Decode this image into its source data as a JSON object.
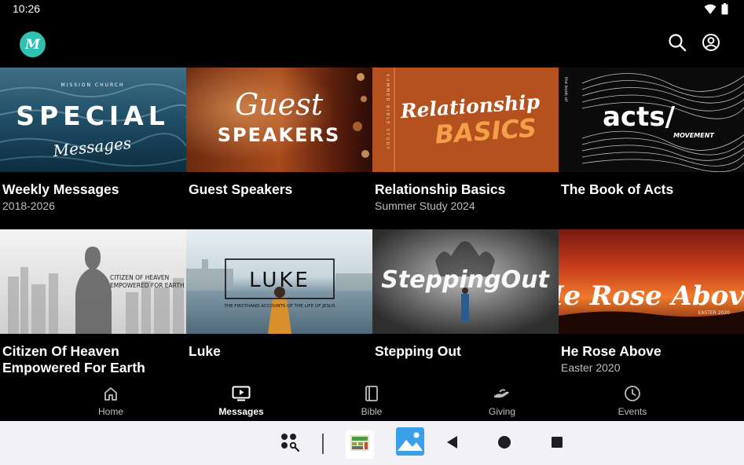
{
  "status_bar": {
    "time": "10:26",
    "icons": [
      "wifi-icon",
      "battery-icon"
    ]
  },
  "app_bar": {
    "logo_letter": "M",
    "actions": [
      "search-icon",
      "account-icon"
    ]
  },
  "cards": [
    {
      "title": "Weekly Messages",
      "subtitle": "2018-2026",
      "art": {
        "top": "MISSION CHURCH",
        "main": "SPECIAL",
        "script": "Messages"
      }
    },
    {
      "title": "Guest Speakers",
      "subtitle": "",
      "art": {
        "script": "Guest",
        "main": "SPEAKERS"
      }
    },
    {
      "title": "Relationship Basics",
      "subtitle": "Summer Study 2024",
      "art": {
        "vertical": "SUMMER BIBLE STUDY",
        "script": "Relationship",
        "main": "BASICS"
      }
    },
    {
      "title": "The Book of Acts",
      "subtitle": "",
      "art": {
        "vertical": "the book of",
        "main": "acts/",
        "small": "MOVEMENT"
      }
    },
    {
      "title": "Citizen Of Heaven Empowered For Earth",
      "subtitle": "",
      "art": {
        "line1": "CITIZEN OF HEAVEN",
        "line2": "EMPOWERED FOR EARTH"
      }
    },
    {
      "title": "Luke",
      "subtitle": "",
      "art": {
        "main": "LUKE",
        "small": "THE FIRSTHAND ACCOUNTS OF THE LIFE OF JESUS"
      }
    },
    {
      "title": "Stepping Out",
      "subtitle": "",
      "art": {
        "main": "SteppingOut"
      }
    },
    {
      "title": "He Rose Above",
      "subtitle": "Easter 2020",
      "art": {
        "main": "He Rose Above",
        "small": "EASTER 2020"
      }
    }
  ],
  "bottom_nav": [
    {
      "label": "Home",
      "icon": "home-icon",
      "active": false
    },
    {
      "label": "Messages",
      "icon": "messages-icon",
      "active": true
    },
    {
      "label": "Bible",
      "icon": "bible-icon",
      "active": false
    },
    {
      "label": "Giving",
      "icon": "giving-icon",
      "active": false
    },
    {
      "label": "Events",
      "icon": "events-icon",
      "active": false
    }
  ],
  "system_bar": [
    "app-drawer-icon",
    "calculator-app-icon",
    "photos-app-icon",
    "back-icon",
    "home-circle-icon",
    "recents-icon"
  ],
  "colors": {
    "accent": "#2fc1b1",
    "background": "#000000",
    "system_bar": "#f2f2f6"
  }
}
